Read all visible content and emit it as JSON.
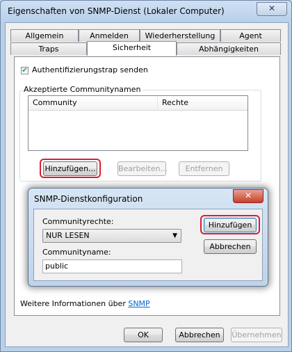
{
  "window": {
    "title": "Eigenschaften von SNMP-Dienst (Lokaler Computer)",
    "close_glyph": "✕"
  },
  "tabs": {
    "row1": [
      "Allgemein",
      "Anmelden",
      "Wiederherstellung",
      "Agent"
    ],
    "row2": [
      "Traps",
      "Sicherheit",
      "Abhängigkeiten"
    ],
    "active": "Sicherheit"
  },
  "security": {
    "auth_trap_label": "Authentifizierungstrap senden",
    "auth_trap_checked": true,
    "communities_group": "Akzeptierte Communitynamen",
    "columns": [
      "Community",
      "Rechte"
    ],
    "add_label": "Hinzufügen...",
    "edit_label": "Bearbeiten...",
    "remove_label": "Entfernen",
    "more_info_prefix": "Weitere Informationen über",
    "more_info_link": "SNMP"
  },
  "footer": {
    "ok_label": "OK",
    "cancel_label": "Abbrechen",
    "apply_label": "Übernehmen"
  },
  "dialog": {
    "title": "SNMP-Dienstkonfiguration",
    "close_glyph": "✕",
    "rights_label": "Communityrechte:",
    "rights_value": "NUR LESEN",
    "name_label": "Communityname:",
    "name_value": "public",
    "add_label": "Hinzufügen",
    "cancel_label": "Abbrechen"
  },
  "colors": {
    "highlight": "#d81e32",
    "link": "#0066cc"
  }
}
